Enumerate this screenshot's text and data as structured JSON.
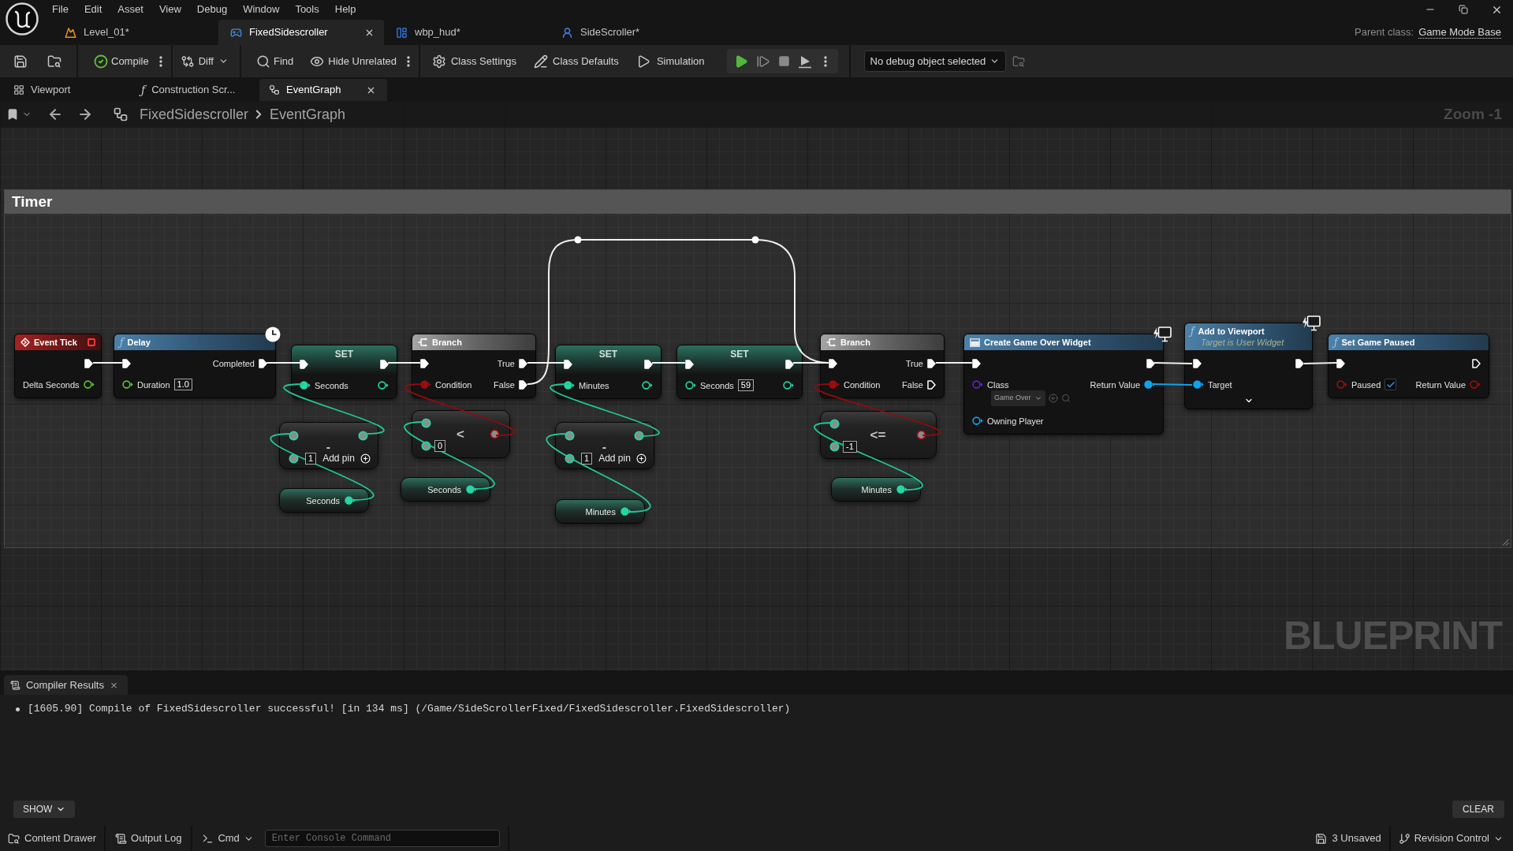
{
  "menu": [
    "File",
    "Edit",
    "Asset",
    "View",
    "Debug",
    "Window",
    "Tools",
    "Help"
  ],
  "document_tabs": [
    {
      "label": "Level_01*",
      "kind": "level",
      "selected": false
    },
    {
      "label": "FixedSidescroller",
      "kind": "blueprint",
      "selected": true
    },
    {
      "label": "wbp_hud*",
      "kind": "widget",
      "selected": false
    },
    {
      "label": "SideScroller*",
      "kind": "character",
      "selected": false
    }
  ],
  "parent_class": {
    "label": "Parent class:",
    "value": "Game Mode Base"
  },
  "toolbar": {
    "compile": "Compile",
    "diff": "Diff",
    "find": "Find",
    "hide_unrelated": "Hide Unrelated",
    "class_settings": "Class Settings",
    "class_defaults": "Class Defaults",
    "simulation": "Simulation",
    "debug_object": "No debug object selected"
  },
  "editor_tabs": [
    {
      "label": "Viewport",
      "kind": "viewport",
      "selected": false
    },
    {
      "label": "Construction Scr...",
      "kind": "function",
      "glyph": "ƒ",
      "selected": false
    },
    {
      "label": "EventGraph",
      "kind": "graph",
      "selected": true
    }
  ],
  "breadcrumb": [
    "FixedSidescroller",
    "EventGraph"
  ],
  "zoom_label": "Zoom -1",
  "comment": {
    "title": "Timer"
  },
  "nodes": [
    {
      "kind": "event",
      "title": "Event Tick",
      "rows": [
        {
          "out": {
            "kind": "exec",
            "connected": true
          }
        },
        {
          "out": {
            "kind": "float",
            "label": "Delta Seconds",
            "connected": false
          }
        }
      ]
    },
    {
      "kind": "function",
      "glyph": "ƒ",
      "title": "Delay",
      "latent": true,
      "rows": [
        {
          "in": {
            "kind": "exec",
            "connected": true
          },
          "out": {
            "kind": "exec",
            "label": "Completed",
            "connected": true
          }
        },
        {
          "in": {
            "kind": "float",
            "label": "Duration",
            "value": "1.0",
            "connected": false
          }
        }
      ]
    },
    {
      "kind": "set",
      "title": "SET",
      "rows": [
        {
          "in": {
            "kind": "exec",
            "connected": true
          },
          "out": {
            "kind": "exec",
            "connected": true
          }
        },
        {
          "in": {
            "kind": "int",
            "label": "Seconds",
            "connected": true
          },
          "out": {
            "kind": "int",
            "connected": false
          }
        }
      ]
    },
    {
      "kind": "branch",
      "title": "Branch",
      "rows": [
        {
          "in": {
            "kind": "exec",
            "connected": true
          },
          "out": {
            "kind": "exec",
            "label": "True",
            "connected": true
          }
        },
        {
          "in": {
            "kind": "bool",
            "label": "Condition",
            "connected": true
          },
          "out": {
            "kind": "exec",
            "label": "False",
            "connected": true
          }
        }
      ]
    },
    {
      "kind": "set",
      "title": "SET",
      "rows": [
        {
          "in": {
            "kind": "exec",
            "connected": true
          },
          "out": {
            "kind": "exec",
            "connected": true
          }
        },
        {
          "in": {
            "kind": "int",
            "label": "Minutes",
            "connected": true
          },
          "out": {
            "kind": "int",
            "connected": false
          }
        }
      ]
    },
    {
      "kind": "set",
      "title": "SET",
      "rows": [
        {
          "in": {
            "kind": "exec",
            "connected": true
          },
          "out": {
            "kind": "exec",
            "connected": true
          }
        },
        {
          "in": {
            "kind": "int",
            "label": "Seconds",
            "value": "59",
            "connected": false
          },
          "out": {
            "kind": "int",
            "connected": false
          }
        }
      ]
    },
    {
      "kind": "branch",
      "title": "Branch",
      "rows": [
        {
          "in": {
            "kind": "exec",
            "connected": true
          },
          "out": {
            "kind": "exec",
            "label": "True",
            "connected": true
          }
        },
        {
          "in": {
            "kind": "bool",
            "label": "Condition",
            "connected": true
          },
          "out": {
            "kind": "exec",
            "label": "False",
            "connected": false
          }
        }
      ]
    },
    {
      "kind": "construct",
      "title": "Create Game Over Widget",
      "widget_badge": true,
      "rows": [
        {
          "in": {
            "kind": "exec",
            "connected": true
          },
          "out": {
            "kind": "exec",
            "connected": true
          }
        },
        {
          "in": {
            "kind": "class",
            "label": "Class",
            "dropdown": "Game Over",
            "connected": false
          },
          "out": {
            "kind": "object",
            "label": "Return Value",
            "connected": true
          }
        },
        {
          "in": {
            "kind": "object",
            "label": "Owning Player",
            "connected": false
          }
        }
      ]
    },
    {
      "kind": "function",
      "glyph": "ƒ",
      "title": "Add to Viewport",
      "subtitle": "Target is User Widget",
      "widget_badge": true,
      "advanced_expanded": false,
      "rows": [
        {
          "in": {
            "kind": "exec",
            "connected": true
          },
          "out": {
            "kind": "exec",
            "connected": true
          }
        },
        {
          "in": {
            "kind": "object",
            "label": "Target",
            "connected": true
          }
        }
      ]
    },
    {
      "kind": "function",
      "glyph": "ƒ",
      "title": "Set Game Paused",
      "rows": [
        {
          "in": {
            "kind": "exec",
            "connected": true
          },
          "out": {
            "kind": "exec",
            "connected": false
          }
        },
        {
          "in": {
            "kind": "bool",
            "label": "Paused",
            "checked": true,
            "connected": false
          },
          "out": {
            "kind": "bool",
            "label": "Return Value",
            "connected": false
          }
        }
      ]
    },
    {
      "kind": "math",
      "symbol": "-",
      "add_pin": "Add pin",
      "rows": [
        {
          "in": {
            "kind": "int"
          },
          "out": {
            "kind": "int"
          }
        },
        {
          "in": {
            "kind": "int",
            "value": "1"
          }
        }
      ]
    },
    {
      "kind": "getter",
      "rows": [
        {
          "out": {
            "kind": "int",
            "label": "Seconds",
            "connected": true
          }
        }
      ]
    },
    {
      "kind": "compare",
      "symbol": "<",
      "rows": [
        {
          "in": {
            "kind": "int"
          },
          "out": {
            "kind": "bool"
          }
        },
        {
          "in": {
            "kind": "int",
            "value": "0"
          }
        }
      ]
    },
    {
      "kind": "getter",
      "rows": [
        {
          "out": {
            "kind": "int",
            "label": "Seconds",
            "connected": true
          }
        }
      ]
    },
    {
      "kind": "math",
      "symbol": "-",
      "add_pin": "Add pin",
      "rows": [
        {
          "in": {
            "kind": "int"
          },
          "out": {
            "kind": "int"
          }
        },
        {
          "in": {
            "kind": "int",
            "value": "1"
          }
        }
      ]
    },
    {
      "kind": "getter",
      "rows": [
        {
          "out": {
            "kind": "int",
            "label": "Minutes",
            "connected": true
          }
        }
      ]
    },
    {
      "kind": "compare",
      "symbol": "<=",
      "rows": [
        {
          "in": {
            "kind": "int"
          },
          "out": {
            "kind": "bool"
          }
        },
        {
          "in": {
            "kind": "int",
            "value": "-1"
          }
        }
      ]
    },
    {
      "kind": "getter",
      "rows": [
        {
          "out": {
            "kind": "int",
            "label": "Minutes",
            "connected": true
          }
        }
      ]
    }
  ],
  "graph_type_label": "BLUEPRINT",
  "compiler_results": {
    "tab": "Compiler Results",
    "messages": [
      "[1605.90] Compile of FixedSidescroller successful! [in 134 ms] (/Game/SideScrollerFixed/FixedSidescroller.FixedSidescroller)"
    ],
    "show_button": "SHOW",
    "clear_button": "CLEAR"
  },
  "status_bar": {
    "content_drawer": "Content Drawer",
    "output_log": "Output Log",
    "cmd": "Cmd",
    "console_placeholder": "Enter Console Command",
    "unsaved": "3 Unsaved",
    "revision_control": "Revision Control"
  }
}
